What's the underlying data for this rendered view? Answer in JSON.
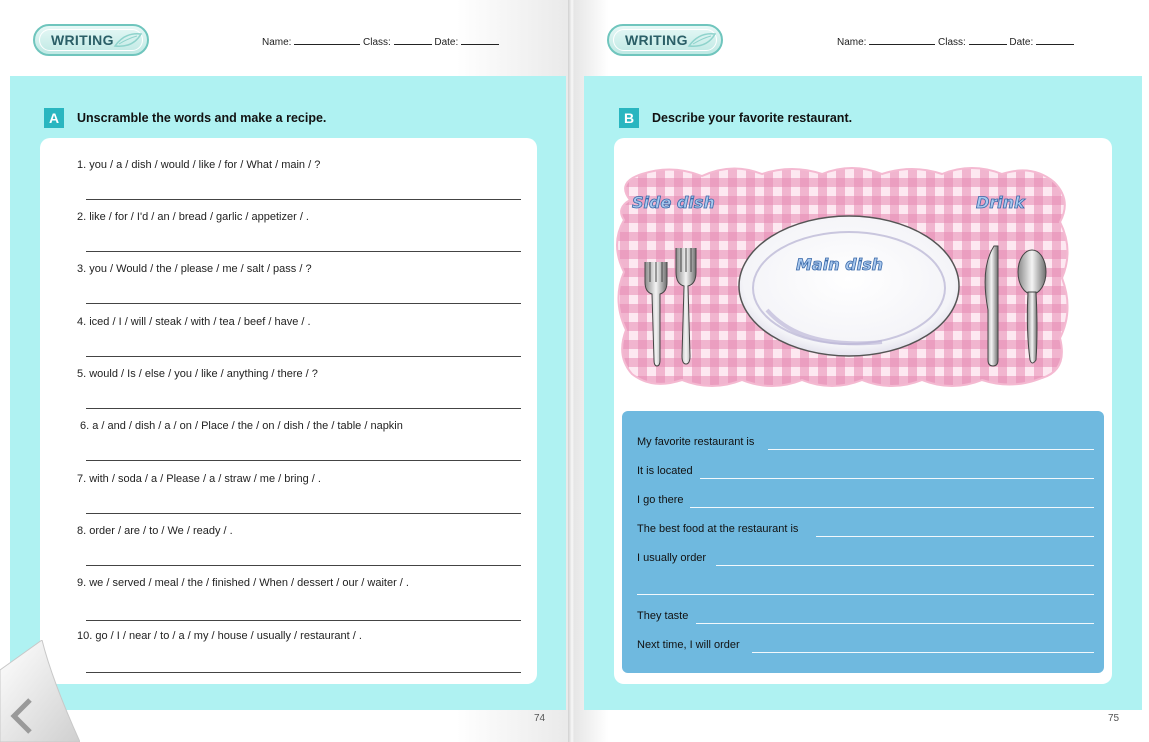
{
  "left_page": {
    "badge": "WRITING",
    "header": {
      "name_label": "Name:",
      "class_label": "Class:",
      "date_label": "Date:"
    },
    "section": {
      "letter": "A",
      "title": "Unscramble the words and make a recipe."
    },
    "questions": [
      "1.  you / a / dish / would / like / for / What / main / ?",
      "2.  like / for / I'd / an / bread / garlic / appetizer / .",
      "3.  you / Would / the / please / me / salt / pass / ?",
      "4.  iced / I / will / steak / with / tea / beef / have / .",
      "5.  would / Is / else / you / like / anything / there / ?",
      "6.  a / and / dish / a / on / Place / the / on / dish / the / table / napkin",
      "7.  with / soda / a / Please / a / straw / me / bring / .",
      "8.  order / are / to / We / ready / .",
      "9.  we / served / meal / the / finished / When / dessert / our / waiter / .",
      "10.  go / I / near / to / a / my / house / usually / restaurant / ."
    ],
    "page_number": "74"
  },
  "right_page": {
    "badge": "WRITING",
    "header": {
      "name_label": "Name:",
      "class_label": "Class:",
      "date_label": "Date:"
    },
    "section": {
      "letter": "B",
      "title": "Describe your favorite restaurant."
    },
    "illustration": {
      "side_dish": "Side dish",
      "main_dish": "Main dish",
      "drink": "Drink"
    },
    "prompts": [
      "My favorite restaurant is",
      "It is located",
      "I go there",
      "The best food at the restaurant is",
      "I usually order",
      "",
      "They taste",
      "Next time, I will order"
    ],
    "page_number": "75"
  },
  "colors": {
    "panel": "#aff2f2",
    "section_letter": "#29b6c0",
    "writing_box": "#6fb9df",
    "tablecloth": "#f2b3d0"
  },
  "icons": {
    "page_curl": "previous-page-icon"
  }
}
